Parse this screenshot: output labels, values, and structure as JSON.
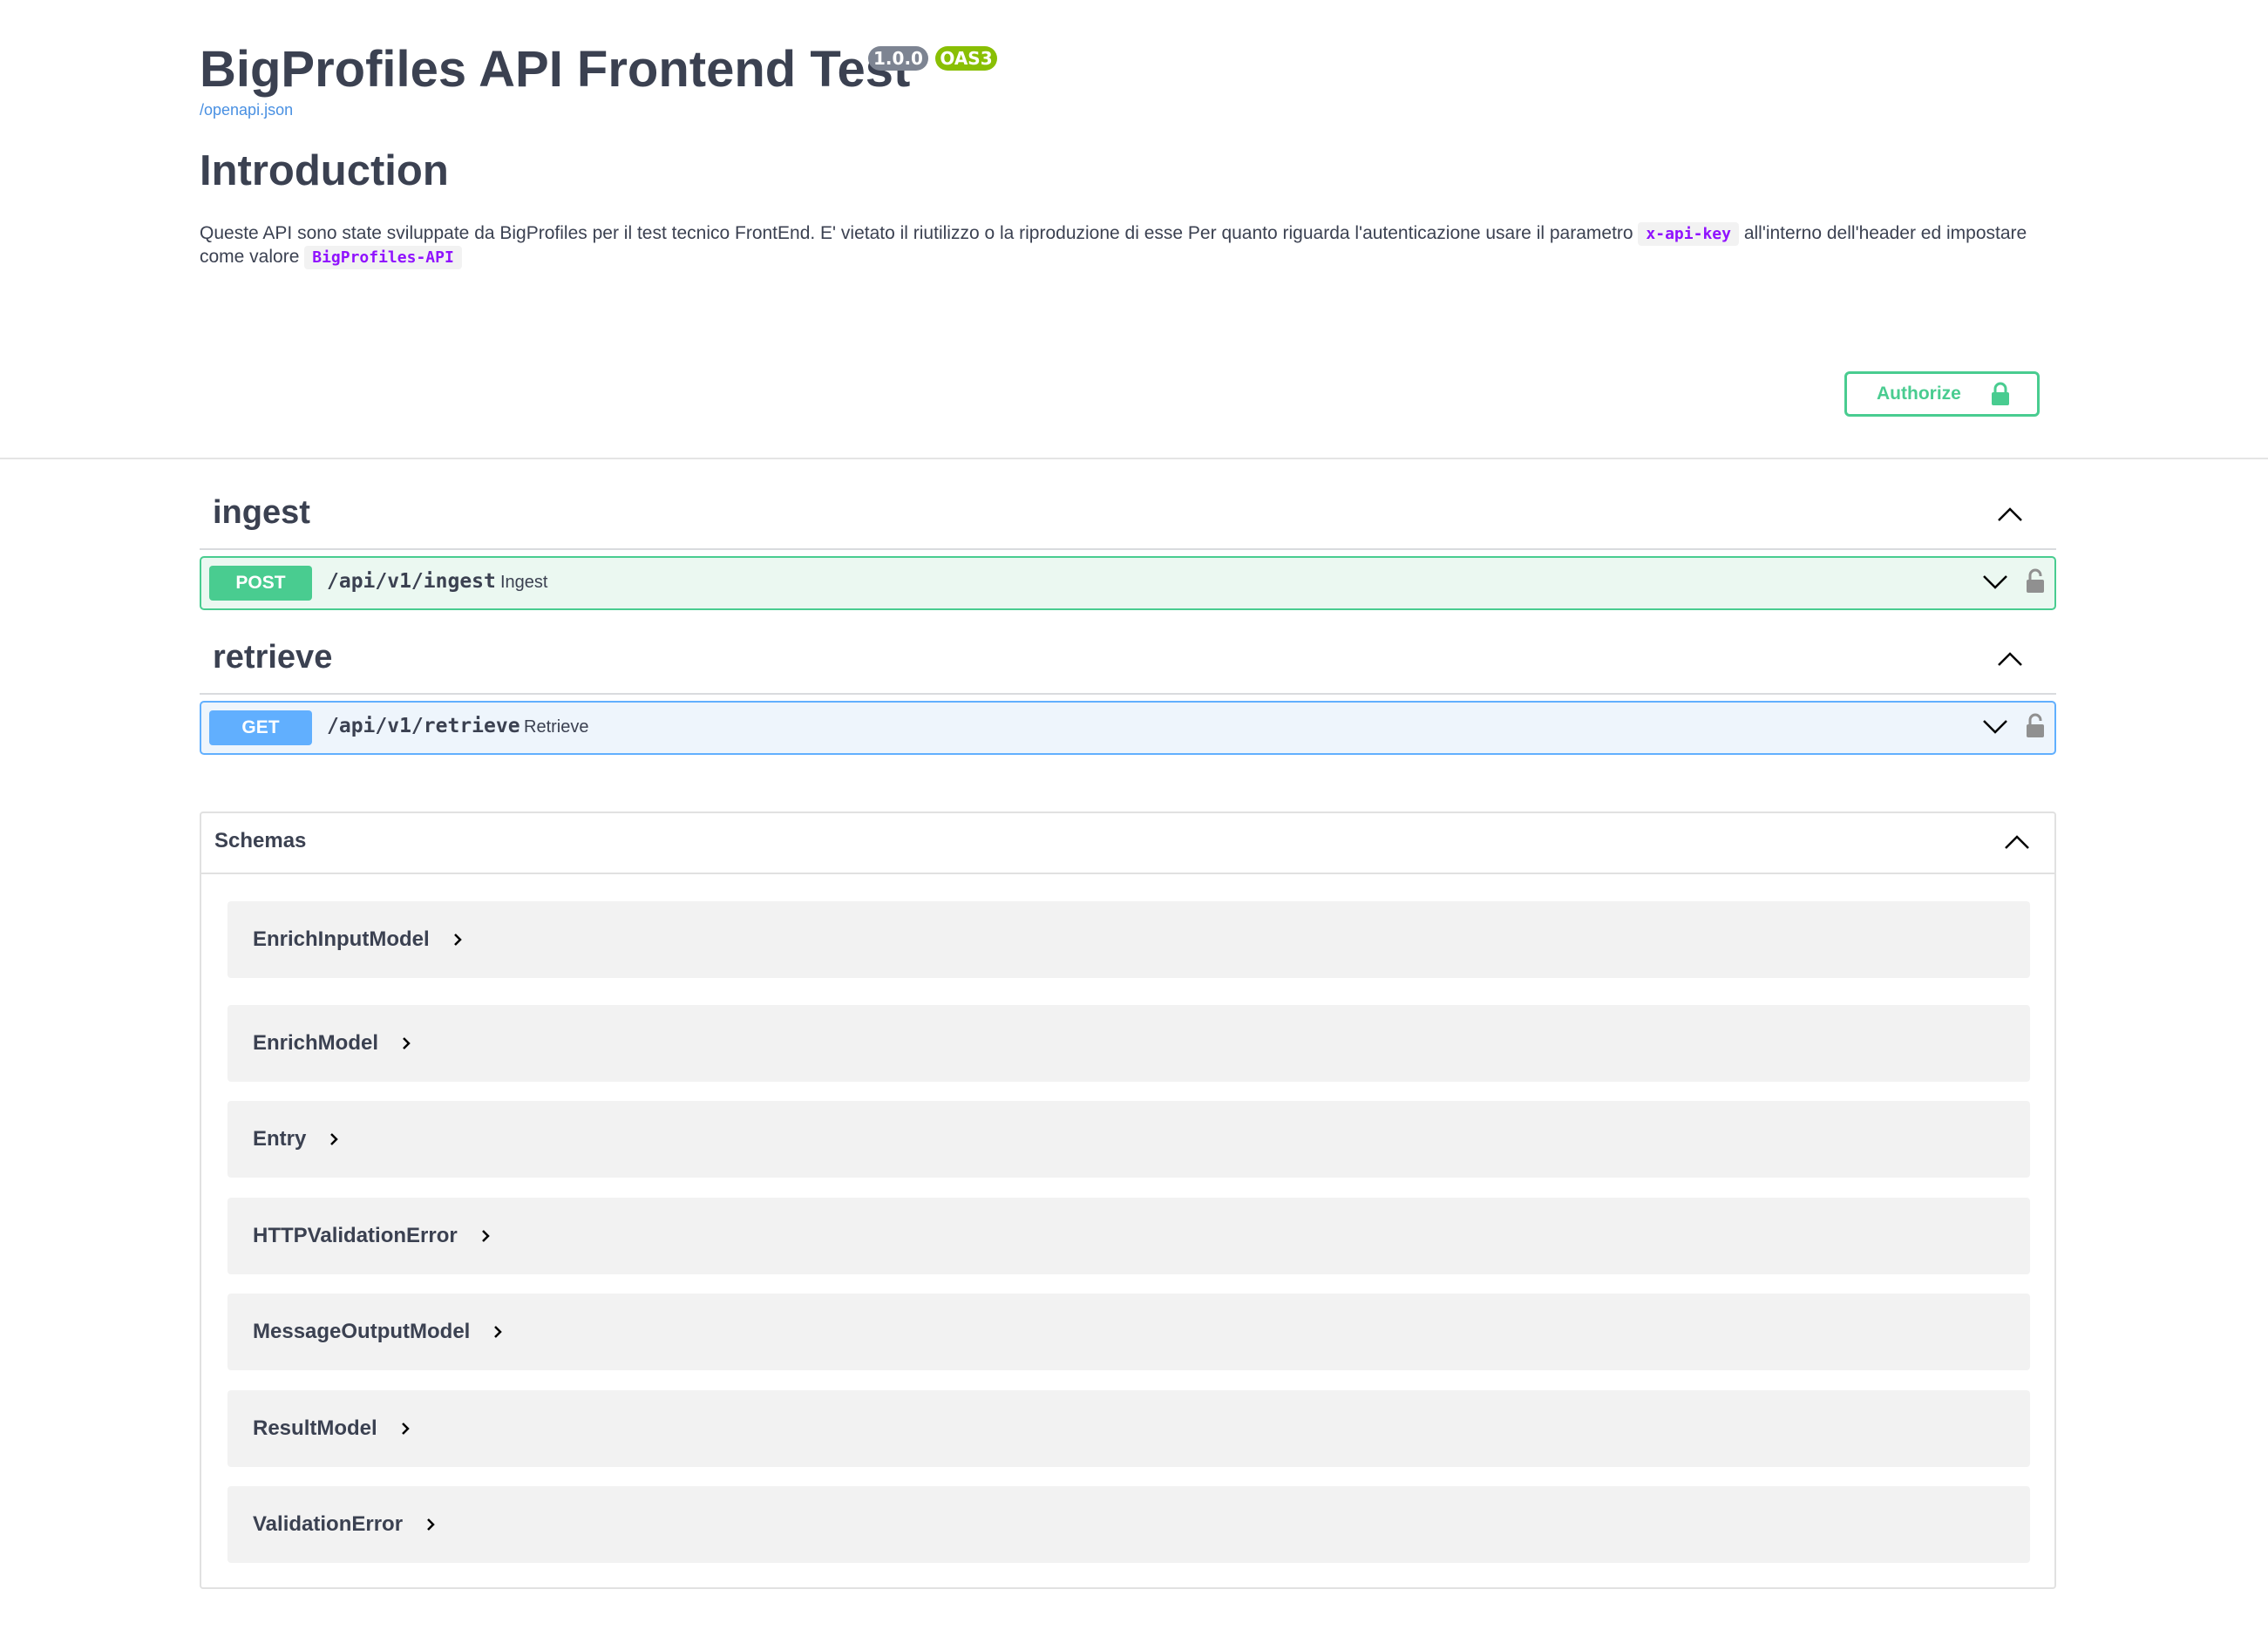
{
  "info": {
    "title": "BigProfiles API Frontend Test",
    "version": "1.0.0",
    "oas_badge": "OAS3",
    "spec_link": "/openapi.json"
  },
  "intro": {
    "heading": "Introduction",
    "text_1": "Queste API sono state sviluppate da BigProfiles per il test tecnico FrontEnd. E' vietato il riutilizzo o la riproduzione di esse Per quanto riguarda l'autenticazione usare il parametro",
    "code_1": "x-api-key",
    "text_2": "all'interno dell'header ed impostare come valore",
    "code_2": "BigProfiles-API"
  },
  "authorize": {
    "label": "Authorize",
    "icon": "lock-icon"
  },
  "tags": [
    {
      "name": "ingest",
      "operation": {
        "method": "POST",
        "path": "/api/v1/ingest",
        "summary": "Ingest"
      }
    },
    {
      "name": "retrieve",
      "operation": {
        "method": "GET",
        "path": "/api/v1/retrieve",
        "summary": "Retrieve"
      }
    }
  ],
  "schemas": {
    "title": "Schemas",
    "models": [
      "EnrichInputModel",
      "EnrichModel",
      "Entry",
      "HTTPValidationError",
      "MessageOutputModel",
      "ResultModel",
      "ValidationError"
    ]
  },
  "colors": {
    "post": "#49cc90",
    "get": "#61affe",
    "code": "#9012fe",
    "link": "#4990e2",
    "oas": "#89bf04",
    "version": "#7d8492"
  }
}
